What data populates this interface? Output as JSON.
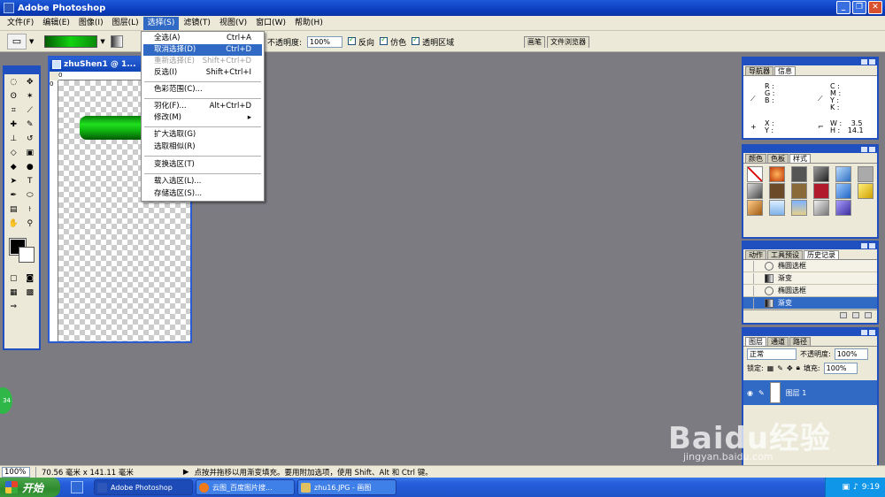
{
  "app": {
    "title": "Adobe Photoshop"
  },
  "menubar": {
    "items": [
      "文件(F)",
      "编辑(E)",
      "图像(I)",
      "图层(L)",
      "选择(S)",
      "滤镜(T)",
      "视图(V)",
      "窗口(W)",
      "帮助(H)"
    ]
  },
  "options": {
    "opacity_label": "不透明度:",
    "opacity_value": "100%",
    "reverse_label": "反向",
    "dither_label": "仿色",
    "transparency_label": "透明区域",
    "well_tabs": [
      "画笔",
      "文件浏览器"
    ]
  },
  "select_menu": {
    "items": [
      {
        "label": "全选(A)",
        "shortcut": "Ctrl+A",
        "state": "normal"
      },
      {
        "label": "取消选择(D)",
        "shortcut": "Ctrl+D",
        "state": "highlighted"
      },
      {
        "label": "重新选择(E)",
        "shortcut": "Shift+Ctrl+D",
        "state": "disabled"
      },
      {
        "label": "反选(I)",
        "shortcut": "Shift+Ctrl+I",
        "state": "normal"
      },
      {
        "label": "色彩范围(C)...",
        "shortcut": "",
        "state": "normal"
      },
      {
        "label": "羽化(F)...",
        "shortcut": "Alt+Ctrl+D",
        "state": "normal"
      },
      {
        "label": "修改(M)",
        "shortcut": "▸",
        "state": "normal"
      },
      {
        "label": "扩大选取(G)",
        "shortcut": "",
        "state": "normal"
      },
      {
        "label": "选取相似(R)",
        "shortcut": "",
        "state": "normal"
      },
      {
        "label": "变换选区(T)",
        "shortcut": "",
        "state": "normal"
      },
      {
        "label": "载入选区(L)...",
        "shortcut": "",
        "state": "normal"
      },
      {
        "label": "存储选区(S)...",
        "shortcut": "",
        "state": "normal"
      }
    ]
  },
  "document": {
    "title": "zhuShen1 @ 1...",
    "ruler_h": "0",
    "ruler_v": "0"
  },
  "navigator": {
    "tabs": [
      "导航器",
      "信息"
    ],
    "rgb": [
      "R :",
      "G :",
      "B :"
    ],
    "cmyk": [
      "C :",
      "M :",
      "Y :",
      "K :"
    ],
    "xy": [
      "X :",
      "Y :"
    ],
    "w_label": "W :",
    "w_value": "3.5",
    "h_label": "H :",
    "h_value": "14.1"
  },
  "styles": {
    "tabs": [
      "颜色",
      "色板",
      "样式"
    ]
  },
  "history": {
    "tabs": [
      "动作",
      "工具预设",
      "历史记录"
    ],
    "rows": [
      "椭圆选框",
      "渐变",
      "椭圆选框",
      "渐变"
    ]
  },
  "layers": {
    "tabs": [
      "图层",
      "通道",
      "路径"
    ],
    "blend_mode": "正常",
    "opacity_label": "不透明度:",
    "opacity_value": "100%",
    "lock_label": "锁定:",
    "fill_label": "填充:",
    "fill_value": "100%",
    "layer_name": "图层 1"
  },
  "status": {
    "zoom": "100%",
    "dimensions": "70.56 毫米 x 141.11 毫米",
    "hint": "点按并拖移以用渐变填充。要用附加选项，使用 Shift、Alt 和 Ctrl 键。"
  },
  "taskbar": {
    "start": "开始",
    "tasks": [
      "Adobe Photoshop",
      "云图_百度图片搜...",
      "zhu16.JPG - 画图"
    ],
    "clock": "9:19"
  },
  "badge": "34",
  "watermark": {
    "main": "Baidu经验",
    "sub": "jingyan.baidu.com"
  }
}
